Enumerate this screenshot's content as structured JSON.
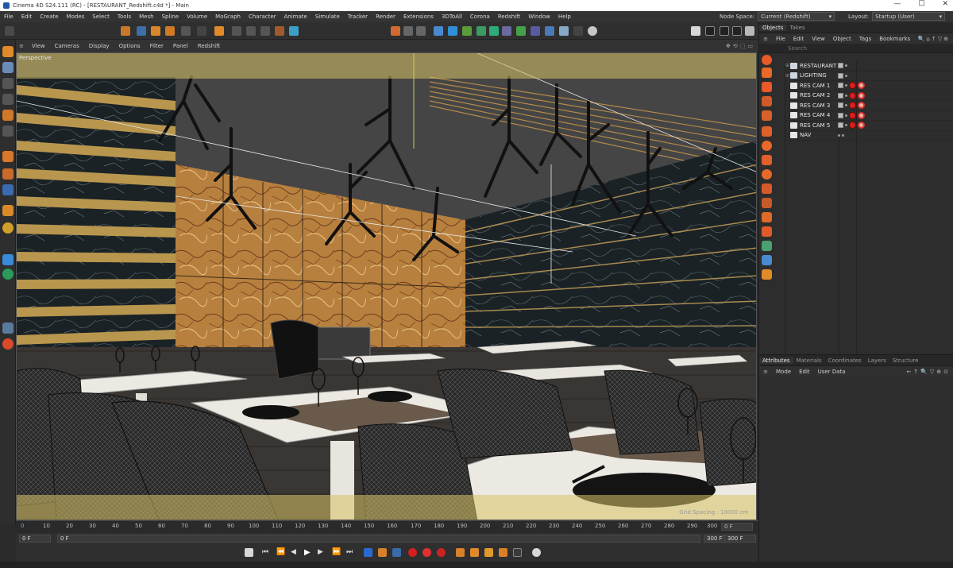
{
  "window": {
    "title": "Cinema 4D S24.111 (RC) - [RESTAURANT_Redshift.c4d *] - Main",
    "controls": [
      "—",
      "☐",
      "✕"
    ]
  },
  "menubar": {
    "items": [
      "File",
      "Edit",
      "Create",
      "Modes",
      "Select",
      "Tools",
      "Mesh",
      "Spline",
      "Volume",
      "MoGraph",
      "Character",
      "Animate",
      "Simulate",
      "Tracker",
      "Render",
      "Extensions",
      "3DToAll",
      "Corona",
      "Redshift",
      "Window",
      "Help"
    ],
    "node_space_label": "Node Space:",
    "node_space_value": "Current (Redshift)",
    "layout_label": "Layout:",
    "layout_value": "Startup (User)"
  },
  "viewport_menu": {
    "items": [
      "View",
      "Cameras",
      "Display",
      "Options",
      "Filter",
      "Panel",
      "Redshift"
    ]
  },
  "viewport": {
    "label": "Perspective",
    "grid_spacing": "Grid Spacing : 10000 cm"
  },
  "timeline": {
    "ticks": [
      "0",
      "10",
      "20",
      "30",
      "40",
      "50",
      "60",
      "70",
      "80",
      "90",
      "100",
      "110",
      "120",
      "130",
      "140",
      "150",
      "160",
      "170",
      "180",
      "190",
      "200",
      "210",
      "220",
      "230",
      "240",
      "250",
      "260",
      "270",
      "280",
      "290",
      "300"
    ],
    "end_label": "0 F"
  },
  "frames": {
    "current": "0 F",
    "start": "0 F",
    "end": "300 F",
    "end2": "300 F"
  },
  "objects_panel": {
    "tabs": [
      "Objects",
      "Takes"
    ],
    "menu": [
      "File",
      "Edit",
      "View",
      "Object",
      "Tags",
      "Bookmarks"
    ],
    "search_placeholder": "Search",
    "rows": [
      {
        "name": "RESTAURANT",
        "tags": 0
      },
      {
        "name": "LIGHTING",
        "tags": 0
      },
      {
        "name": "RES CAM 1",
        "tags": 2
      },
      {
        "name": "RES CAM 2",
        "tags": 2
      },
      {
        "name": "RES CAM 3",
        "tags": 2
      },
      {
        "name": "RES CAM 4",
        "tags": 2
      },
      {
        "name": "RES CAM 5",
        "tags": 2
      },
      {
        "name": "NAV",
        "tags": 0
      }
    ]
  },
  "attributes_panel": {
    "tabs": [
      "Attributes",
      "Materials",
      "Coordinates",
      "Layers",
      "Structure"
    ],
    "menu": [
      "Mode",
      "Edit",
      "User Data"
    ]
  },
  "colors": {
    "accent_orange": "#e8731a",
    "tag_red": "#d82020",
    "viewport_safe_frame": "#d8c364"
  }
}
